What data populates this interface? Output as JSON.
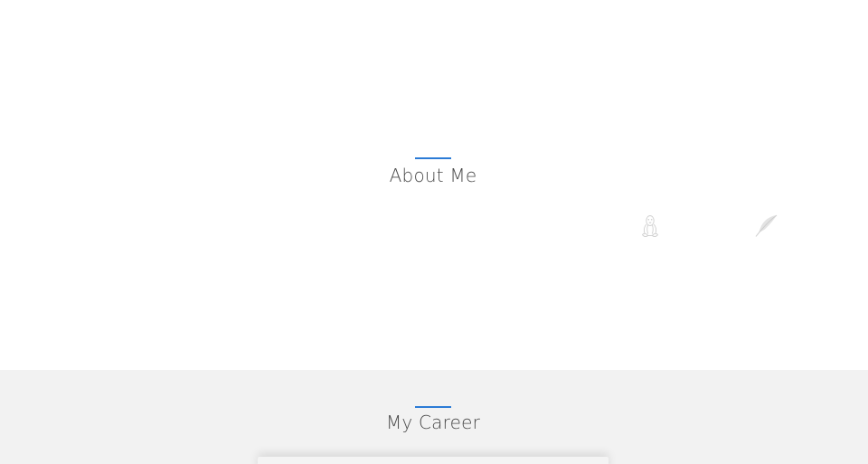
{
  "about": {
    "title": "About Me"
  },
  "career": {
    "title": "My Career"
  },
  "icons": {
    "linux": "linux-penguin-icon",
    "feather": "feather-icon"
  },
  "colors": {
    "accent": "#2b7bd6",
    "career_background": "#f2f2f2",
    "heading_text": "#4a4a4a"
  }
}
